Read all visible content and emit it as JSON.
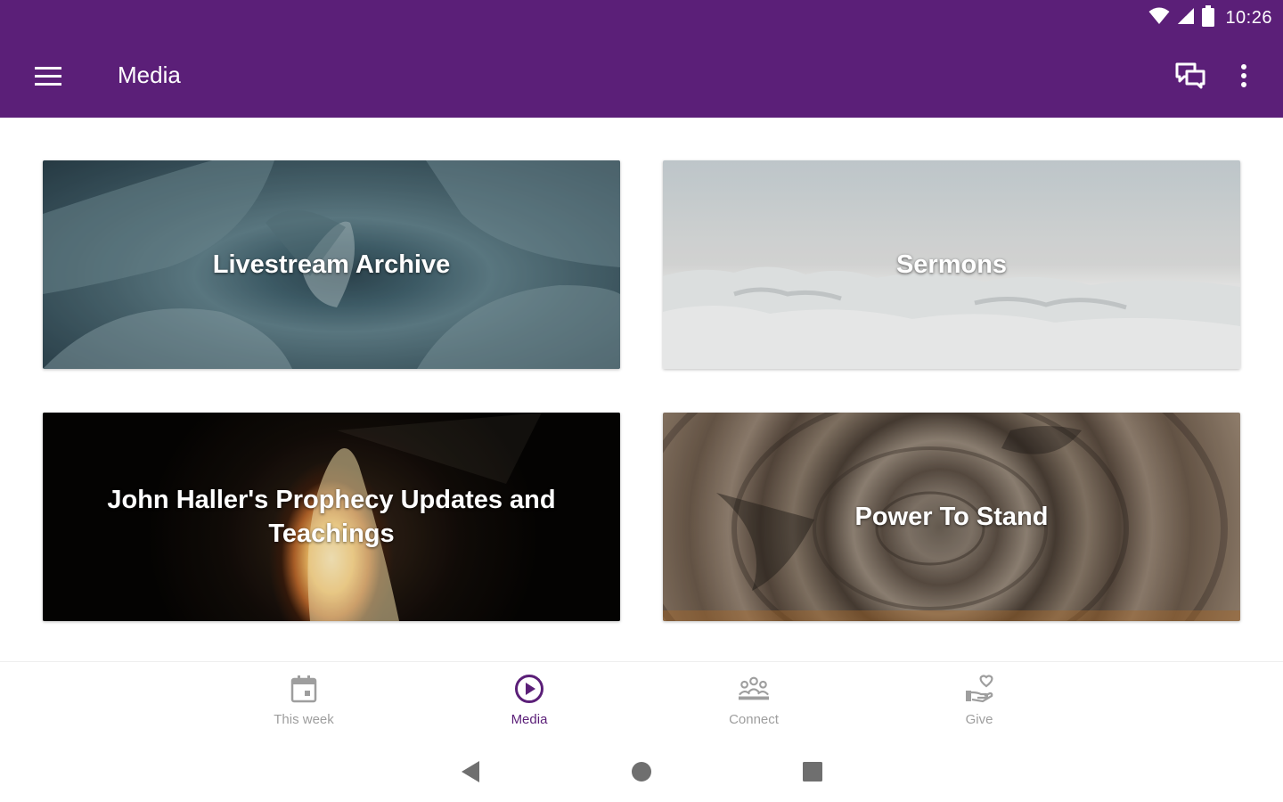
{
  "status_bar": {
    "time": "10:26",
    "icons": [
      "wifi-icon",
      "cell-signal-icon",
      "battery-icon"
    ]
  },
  "app_bar": {
    "title": "Media",
    "menu_icon": "hamburger-menu-icon",
    "actions": [
      "chat-icon",
      "more-vert-icon"
    ],
    "color": "#5b1f78"
  },
  "cards": [
    {
      "label": "Livestream Archive",
      "image": "agave-plant"
    },
    {
      "label": "Sermons",
      "image": "sea-of-clouds"
    },
    {
      "label": "John Haller's Prophecy Updates and Teachings",
      "image": "empty-tomb-cave"
    },
    {
      "label": "Power To Stand",
      "image": "tree-rings-wood"
    }
  ],
  "bottom_nav": {
    "items": [
      {
        "label": "This week",
        "icon": "calendar-icon",
        "active": false
      },
      {
        "label": "Media",
        "icon": "play-circle-icon",
        "active": true
      },
      {
        "label": "Connect",
        "icon": "people-group-icon",
        "active": false
      },
      {
        "label": "Give",
        "icon": "hand-heart-icon",
        "active": false
      }
    ],
    "active_color": "#5b1f78",
    "inactive_color": "#9e9e9e"
  },
  "system_nav": {
    "buttons": [
      "back-icon",
      "home-icon",
      "recents-icon"
    ]
  }
}
